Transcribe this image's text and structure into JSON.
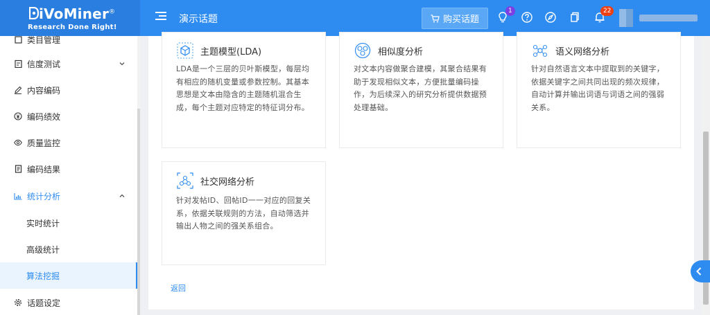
{
  "header": {
    "logo_text": "iVoMiner",
    "logo_initial": "D",
    "logo_reg": "®",
    "tagline": "Research Done Right!",
    "topic_title": "演示话题",
    "buy_label": "购买话题",
    "lightbulb_badge": "1",
    "notification_badge": "22",
    "colors": {
      "header": "#2e8cf0",
      "accent": "#2e8cf0",
      "badge_purple": "#7b3fe4",
      "badge_red": "#ed4014"
    }
  },
  "sidebar": {
    "items": [
      {
        "label": "类目管理",
        "icon": "square-icon"
      },
      {
        "label": "信度测试",
        "icon": "clipboard-icon",
        "expandable": true
      },
      {
        "label": "内容编码",
        "icon": "pencil-icon"
      },
      {
        "label": "编码绩效",
        "icon": "yen-icon"
      },
      {
        "label": "质量监控",
        "icon": "eye-icon"
      },
      {
        "label": "编码结果",
        "icon": "document-icon"
      },
      {
        "label": "统计分析",
        "icon": "bar-chart-icon",
        "expanded": true
      },
      {
        "label": "实时统计"
      },
      {
        "label": "高级统计"
      },
      {
        "label": "算法挖掘",
        "active": true
      },
      {
        "label": "话题设定",
        "icon": "gear-icon"
      }
    ]
  },
  "cards": [
    {
      "title": "主题模型(LDA)",
      "icon": "cube-network-icon",
      "description": "LDA是一个三层的贝叶斯模型，每层均有相应的随机变量或参数控制。其基本思想是文本由隐含的主题随机混合生成，每个主题对应特定的特征词分布。"
    },
    {
      "title": "相似度分析",
      "icon": "similarity-icon",
      "description": "对文本内容做聚合建模，其聚合结果有助于发现相似文本，方便批量编码操作，为后续深入的研究分析提供数据预处理基础。"
    },
    {
      "title": "语义网络分析",
      "icon": "semantic-network-icon",
      "description": "针对自然语言文本中提取到的关键字，依据关键字之间共同出现的频次规律，自动计算并输出词语与词语之间的强弱关系。"
    },
    {
      "title": "社交网络分析",
      "icon": "social-network-icon",
      "description": "针对发帖ID、回帖ID一一对应的回复关系，依据关联规则的方法，自动筛选并输出人物之间的强关系组合。"
    }
  ],
  "back_label": "返回"
}
